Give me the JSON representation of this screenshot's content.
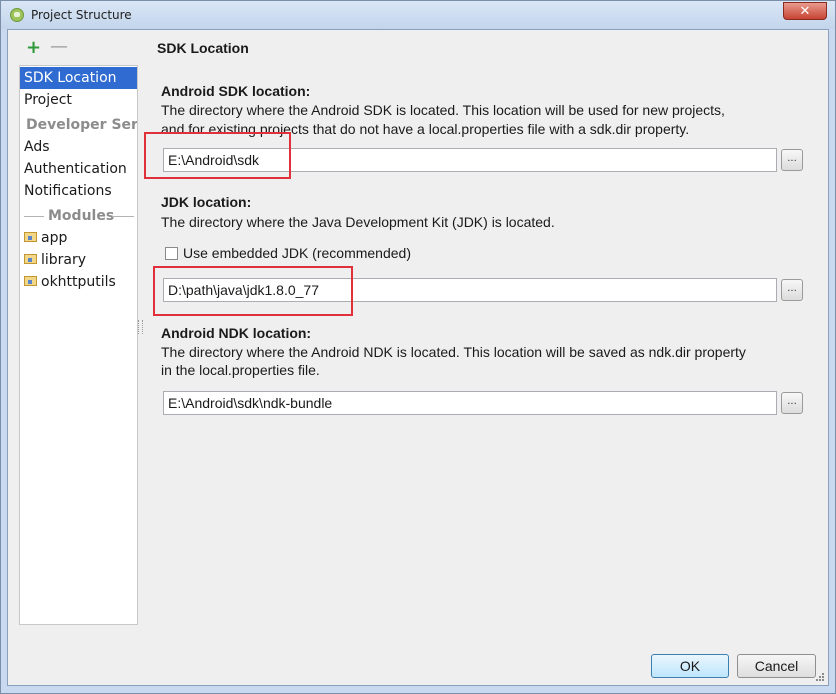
{
  "window": {
    "title": "Project Structure",
    "close_label": "✕"
  },
  "toolbar": {
    "add_label": "+",
    "remove_label": "—"
  },
  "sidebar": {
    "items": [
      {
        "label": "SDK Location",
        "selected": true
      },
      {
        "label": "Project"
      }
    ],
    "developer_header": "Developer Ser...",
    "developer_items": [
      {
        "label": "Ads"
      },
      {
        "label": "Authentication"
      },
      {
        "label": "Notifications"
      }
    ],
    "modules_header": "Modules",
    "modules": [
      {
        "label": "app",
        "icon": "module-folder-icon"
      },
      {
        "label": "library",
        "icon": "module-folder-icon"
      },
      {
        "label": "okhttputils",
        "icon": "module-folder-icon"
      }
    ]
  },
  "panel": {
    "title": "SDK Location",
    "android_sdk": {
      "label": "Android SDK location:",
      "desc_line1": "The directory where the Android SDK is located. This location will be used for new projects,",
      "desc_line2": "and for existing projects that do not have a local.properties file with a sdk.dir property.",
      "value": "E:\\Android\\sdk",
      "browse_label": "..."
    },
    "jdk": {
      "label": "JDK location:",
      "desc": "The directory where the Java Development Kit (JDK) is located.",
      "embedded_checkbox_label": "Use embedded JDK (recommended)",
      "embedded_checked": false,
      "value": "D:\\path\\java\\jdk1.8.0_77",
      "browse_label": "..."
    },
    "ndk": {
      "label": "Android NDK location:",
      "desc_line1": "The directory where the Android NDK is located. This location will be saved as ndk.dir property",
      "desc_line2": "in the local.properties file.",
      "value": "E:\\Android\\sdk\\ndk-bundle",
      "browse_label": "..."
    }
  },
  "buttons": {
    "ok": "OK",
    "cancel": "Cancel"
  },
  "colors": {
    "selection": "#2f6bd1",
    "highlight": "#e0303a",
    "add_icon": "#2e9a3a"
  }
}
